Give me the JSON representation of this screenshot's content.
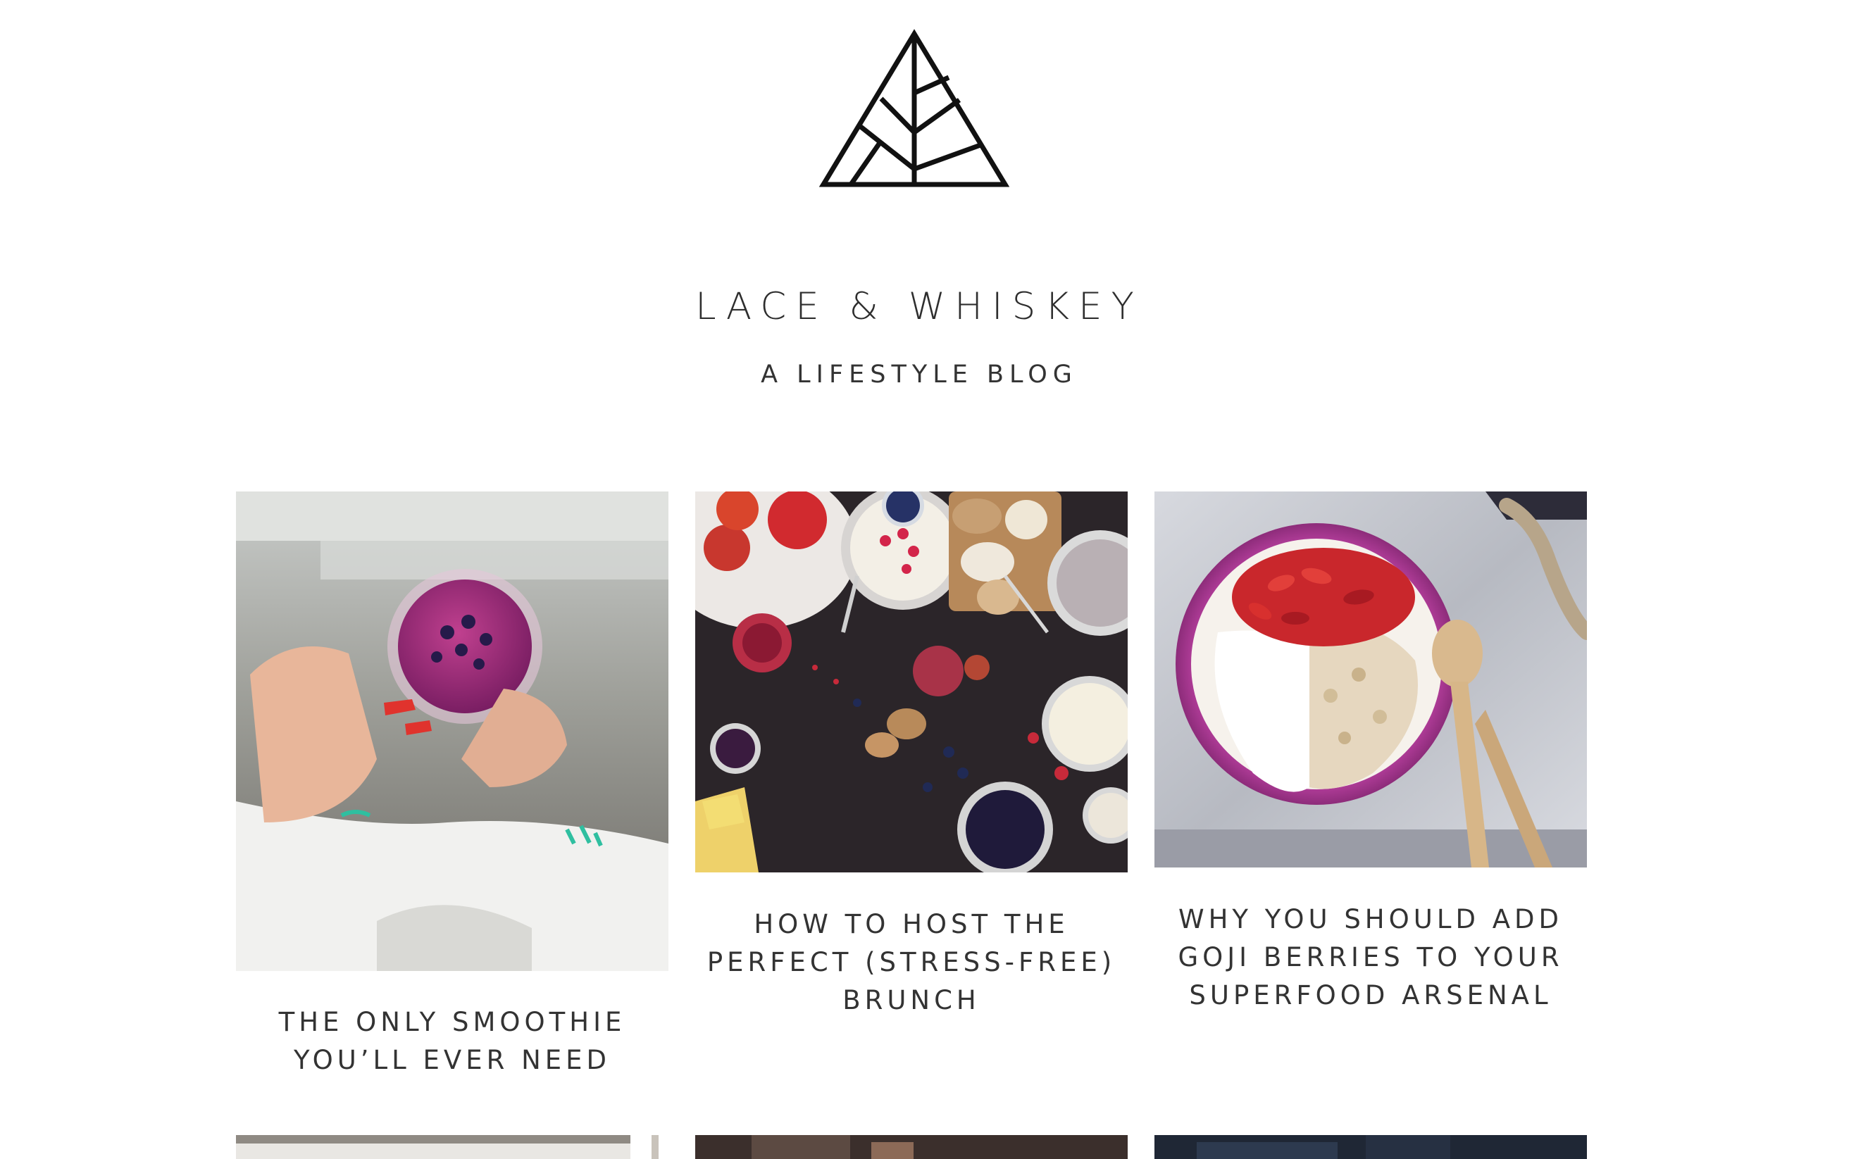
{
  "site": {
    "title": "LACE & WHISKEY",
    "tagline": "A LIFESTYLE BLOG"
  },
  "posts": [
    {
      "title_lines": [
        "THE ONLY SMOOTHIE",
        "YOU’LL EVER NEED"
      ],
      "image": "smoothie-photo"
    },
    {
      "title_lines": [
        "HOW TO HOST THE",
        "PERFECT (STRESS-FREE)",
        "BRUNCH"
      ],
      "image": "brunch-table-photo"
    },
    {
      "title_lines": [
        "WHY YOU SHOULD ADD",
        "GOJI BERRIES TO YOUR",
        "SUPERFOOD ARSENAL"
      ],
      "image": "goji-bowl-photo"
    }
  ],
  "icons": {
    "logo": "triangle-leaf-logo"
  }
}
